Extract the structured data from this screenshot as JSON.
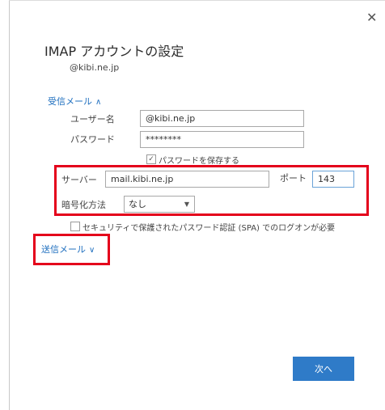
{
  "dialog": {
    "close_glyph": "✕",
    "title": "IMAP アカウントの設定",
    "email": "@kibi.ne.jp"
  },
  "incoming": {
    "section_label": "受信メール",
    "chevron": "∧",
    "username_label": "ユーザー名",
    "username_value": "@kibi.ne.jp",
    "password_label": "パスワード",
    "password_value": "********",
    "save_password_label": "パスワードを保存する",
    "save_password_checked": true,
    "server_label": "サーバー",
    "server_value": "mail.kibi.ne.jp",
    "port_label": "ポート",
    "port_value": "143",
    "encryption_label": "暗号化方法",
    "encryption_value": "なし",
    "spa_label": "セキュリティで保護されたパスワード認証 (SPA) でのログオンが必要",
    "spa_checked": false
  },
  "outgoing": {
    "section_label": "送信メール",
    "chevron": "∨"
  },
  "footer": {
    "next_label": "次へ"
  },
  "colors": {
    "accent": "#2f7bc8",
    "link": "#1f6fbf",
    "highlight": "#e4001b"
  }
}
